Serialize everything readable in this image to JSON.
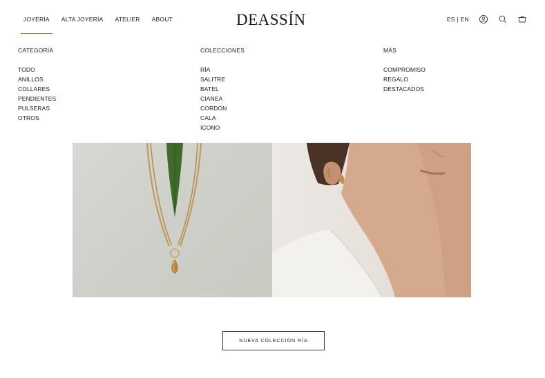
{
  "nav": {
    "items": [
      {
        "label": "JOYERÍA"
      },
      {
        "label": "ALTA JOYERÍA"
      },
      {
        "label": "ATELIER"
      },
      {
        "label": "ABOUT"
      }
    ]
  },
  "brand": {
    "logo": "DEASSÍN"
  },
  "header_right": {
    "language": "ES | EN",
    "icons": [
      "account-icon",
      "search-icon",
      "cart-icon"
    ]
  },
  "menu": {
    "columns": [
      {
        "heading": "CATEGORÍA",
        "items": [
          "TODO",
          "ANILLOS",
          "COLLARES",
          "PENDIENTES",
          "PULSERAS",
          "OTROS"
        ]
      },
      {
        "heading": "COLECCIONES",
        "items": [
          "RÍA",
          "SALITRE",
          "BATEL",
          "CIANEA",
          "CORDÓN",
          "CALA",
          "ICONO"
        ]
      },
      {
        "heading": "MÁS",
        "items": [
          "COMPROMISO",
          "REGALO",
          "DESTACADOS"
        ]
      }
    ]
  },
  "banner": {
    "cta_label": "NUEVA COLECCIÓN RÍA"
  },
  "colors": {
    "accent_underline": "#6f8a4e",
    "text": "#1a1a1a"
  }
}
